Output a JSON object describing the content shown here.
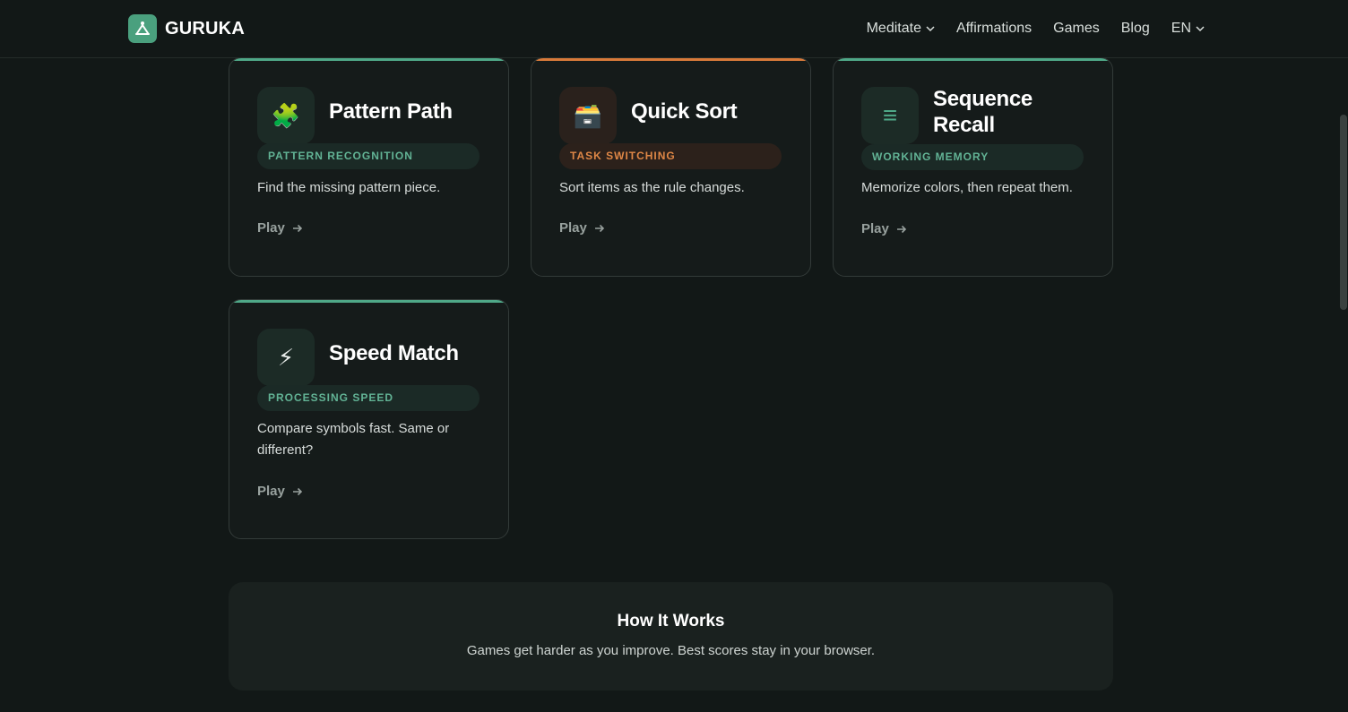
{
  "header": {
    "brand": "GURUKA",
    "nav": [
      {
        "label": "Meditate",
        "has_dropdown": true
      },
      {
        "label": "Affirmations",
        "has_dropdown": false
      },
      {
        "label": "Games",
        "has_dropdown": false
      },
      {
        "label": "Blog",
        "has_dropdown": false
      },
      {
        "label": "EN",
        "has_dropdown": true
      }
    ]
  },
  "games": [
    {
      "title": "Pattern Path",
      "tag": "PATTERN RECOGNITION",
      "description": "Find the missing pattern piece.",
      "play_label": "Play",
      "icon": "puzzle-icon",
      "glyph": "🧩",
      "accent": "#4fa888"
    },
    {
      "title": "Quick Sort",
      "tag": "TASK SWITCHING",
      "description": "Sort items as the rule changes.",
      "play_label": "Play",
      "icon": "card-box-icon",
      "glyph": "🗃️",
      "accent": "#d87a3a"
    },
    {
      "title": "Sequence Recall",
      "tag": "WORKING MEMORY",
      "description": "Memorize colors, then repeat them.",
      "play_label": "Play",
      "icon": "list-icon",
      "glyph": "≡",
      "accent": "#4fa888"
    },
    {
      "title": "Speed Match",
      "tag": "PROCESSING SPEED",
      "description": "Compare symbols fast. Same or different?",
      "play_label": "Play",
      "icon": "lightning-icon",
      "glyph": "⚡",
      "accent": "#4fa888"
    }
  ],
  "how_it_works": {
    "title": "How It Works",
    "description": "Games get harder as you improve. Best scores stay in your browser."
  },
  "colors": {
    "background": "#121817",
    "green_accent": "#4fa888",
    "orange_accent": "#d87a3a"
  }
}
